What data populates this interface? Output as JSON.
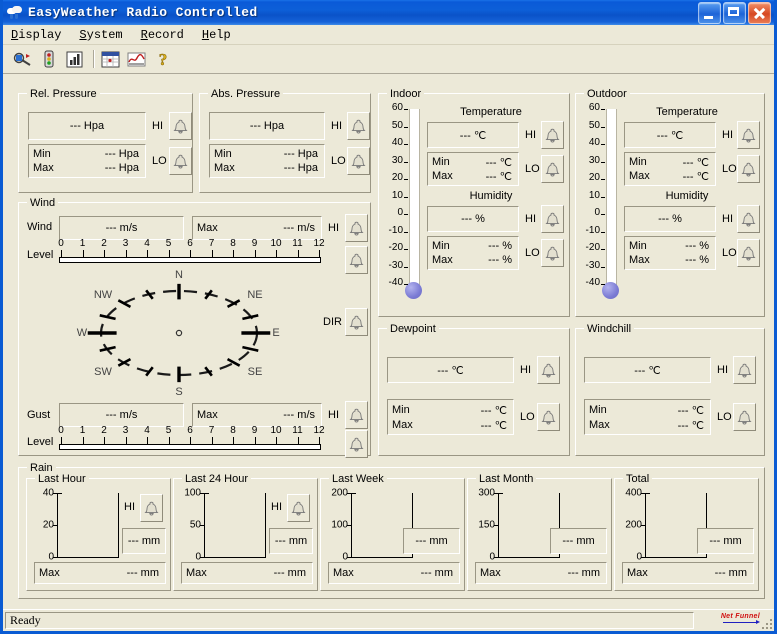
{
  "window": {
    "title": "EasyWeather Radio Controlled",
    "icon": "weather-cloud-icon",
    "minimize_label": "Minimize",
    "maximize_label": "Maximize",
    "close_label": "Close"
  },
  "menubar": {
    "items": [
      {
        "label": "Display",
        "accel": "D"
      },
      {
        "label": "System",
        "accel": "S"
      },
      {
        "label": "Record",
        "accel": "R"
      },
      {
        "label": "Help",
        "accel": "H"
      }
    ]
  },
  "toolbar": {
    "buttons": [
      {
        "name": "connect-icon",
        "title": "Connect"
      },
      {
        "name": "traffic-light-icon",
        "title": "Status"
      },
      {
        "name": "bar-chart-icon",
        "title": "Bar Chart"
      },
      {
        "name": "calendar-icon",
        "title": "Records"
      },
      {
        "name": "line-chart-icon",
        "title": "Graph"
      },
      {
        "name": "help-question-icon",
        "title": "Help"
      }
    ]
  },
  "placeholders": {
    "hpa": "--- Hpa",
    "celsius": "--- ℃",
    "percent": "--- %",
    "ms": "--- m/s",
    "mm": "--- mm"
  },
  "labels": {
    "min": "Min",
    "max": "Max",
    "hi": "HI",
    "lo": "LO",
    "dir": "DIR",
    "level": "Level",
    "wind": "Wind",
    "gust": "Gust",
    "temperature": "Temperature",
    "humidity": "Humidity"
  },
  "rel_pressure": {
    "title": "Rel. Pressure",
    "current": "--- Hpa",
    "min_label": "Min",
    "min_value": "--- Hpa",
    "max_label": "Max",
    "max_value": "--- Hpa",
    "hi_label": "HI",
    "lo_label": "LO"
  },
  "abs_pressure": {
    "title": "Abs. Pressure",
    "current": "--- Hpa",
    "min_label": "Min",
    "min_value": "--- Hpa",
    "max_label": "Max",
    "max_value": "--- Hpa",
    "hi_label": "HI",
    "lo_label": "LO"
  },
  "wind": {
    "title": "Wind",
    "wind_label": "Wind",
    "wind_value": "--- m/s",
    "wind_max_label": "Max",
    "wind_max_value": "--- m/s",
    "wind_hi_label": "HI",
    "wind_level_label": "Level",
    "gust_label": "Gust",
    "gust_value": "--- m/s",
    "gust_max_label": "Max",
    "gust_max_value": "--- m/s",
    "gust_hi_label": "HI",
    "gust_level_label": "Level",
    "dir_label": "DIR",
    "level_ticks": [
      "0",
      "1",
      "2",
      "3",
      "4",
      "5",
      "6",
      "7",
      "8",
      "9",
      "10",
      "11",
      "12"
    ],
    "compass_points": [
      "N",
      "NE",
      "E",
      "SE",
      "S",
      "SW",
      "W",
      "NW"
    ]
  },
  "indoor": {
    "title": "Indoor",
    "temperature_title": "Temperature",
    "temperature_value": "--- ℃",
    "temp_min_label": "Min",
    "temp_min_value": "--- ℃",
    "temp_max_label": "Max",
    "temp_max_value": "--- ℃",
    "temp_hi_label": "HI",
    "temp_lo_label": "LO",
    "humidity_title": "Humidity",
    "humidity_value": "--- %",
    "hum_min_label": "Min",
    "hum_min_value": "--- %",
    "hum_max_label": "Max",
    "hum_max_value": "--- %",
    "hum_hi_label": "HI",
    "hum_lo_label": "LO",
    "scale": [
      "60",
      "50",
      "40",
      "30",
      "20",
      "10",
      "0",
      "-10",
      "-20",
      "-30",
      "-40"
    ]
  },
  "outdoor": {
    "title": "Outdoor",
    "temperature_title": "Temperature",
    "temperature_value": "--- ℃",
    "temp_min_label": "Min",
    "temp_min_value": "--- ℃",
    "temp_max_label": "Max",
    "temp_max_value": "--- ℃",
    "temp_hi_label": "HI",
    "temp_lo_label": "LO",
    "humidity_title": "Humidity",
    "humidity_value": "--- %",
    "hum_min_label": "Min",
    "hum_min_value": "--- %",
    "hum_max_label": "Max",
    "hum_max_value": "--- %",
    "hum_hi_label": "HI",
    "hum_lo_label": "LO",
    "scale": [
      "60",
      "50",
      "40",
      "30",
      "20",
      "10",
      "0",
      "-10",
      "-20",
      "-30",
      "-40"
    ]
  },
  "dewpoint": {
    "title": "Dewpoint",
    "current": "--- ℃",
    "min_label": "Min",
    "min_value": "--- ℃",
    "max_label": "Max",
    "max_value": "--- ℃",
    "hi_label": "HI",
    "lo_label": "LO"
  },
  "windchill": {
    "title": "Windchill",
    "current": "--- ℃",
    "min_label": "Min",
    "min_value": "--- ℃",
    "max_label": "Max",
    "max_value": "--- ℃",
    "hi_label": "HI",
    "lo_label": "LO"
  },
  "rain": {
    "title": "Rain",
    "panels": [
      {
        "title": "Last Hour",
        "value": "--- mm",
        "max_label": "Max",
        "max_value": "--- mm",
        "hi_label": "HI",
        "has_hi": true,
        "scale": [
          "40",
          "20",
          "0"
        ]
      },
      {
        "title": "Last 24 Hour",
        "value": "--- mm",
        "max_label": "Max",
        "max_value": "--- mm",
        "hi_label": "HI",
        "has_hi": true,
        "scale": [
          "100",
          "50",
          "0"
        ]
      },
      {
        "title": "Last Week",
        "value": "--- mm",
        "max_label": "Max",
        "max_value": "--- mm",
        "hi_label": "",
        "has_hi": false,
        "scale": [
          "200",
          "100",
          "0"
        ]
      },
      {
        "title": "Last Month",
        "value": "--- mm",
        "max_label": "Max",
        "max_value": "--- mm",
        "hi_label": "",
        "has_hi": false,
        "scale": [
          "300",
          "150",
          "0"
        ]
      },
      {
        "title": "Total",
        "value": "--- mm",
        "max_label": "Max",
        "max_value": "--- mm",
        "hi_label": "",
        "has_hi": false,
        "scale": [
          "400",
          "200",
          "0"
        ]
      }
    ]
  },
  "statusbar": {
    "message": "Ready",
    "brand": "Net Funnel"
  },
  "colors": {
    "titlebar_blue": "#0a5ad8",
    "window_face": "#ece9d8",
    "bulb_blue": "#7b7bd4",
    "brand_red": "#d01010",
    "close_red": "#d64822"
  }
}
